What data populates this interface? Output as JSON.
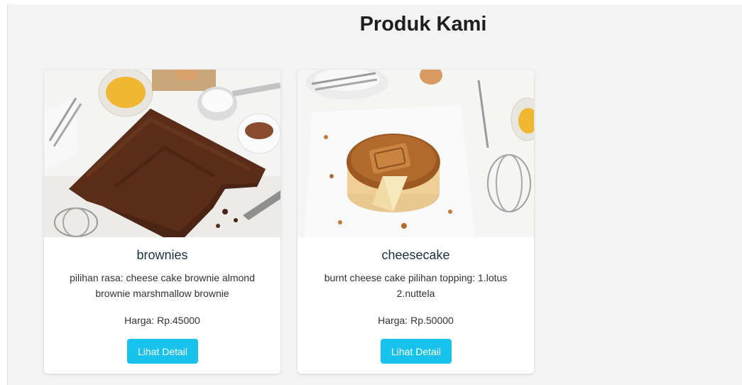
{
  "page": {
    "title": "Produk Kami"
  },
  "products": [
    {
      "name": "brownies",
      "description": "pilihan rasa: cheese cake brownie almond brownie marshmallow brownie",
      "price": "Harga: Rp.45000",
      "button_label": "Lihat Detail",
      "image": "brownies-photo"
    },
    {
      "name": "cheesecake",
      "description": "burnt cheese cake pilihan topping: 1.lotus 2.nuttela",
      "price": "Harga: Rp.50000",
      "button_label": "Lihat Detail",
      "image": "cheesecake-photo"
    }
  ],
  "colors": {
    "accent": "#17c2ec",
    "background": "#f3f3f3",
    "card": "#ffffff"
  }
}
